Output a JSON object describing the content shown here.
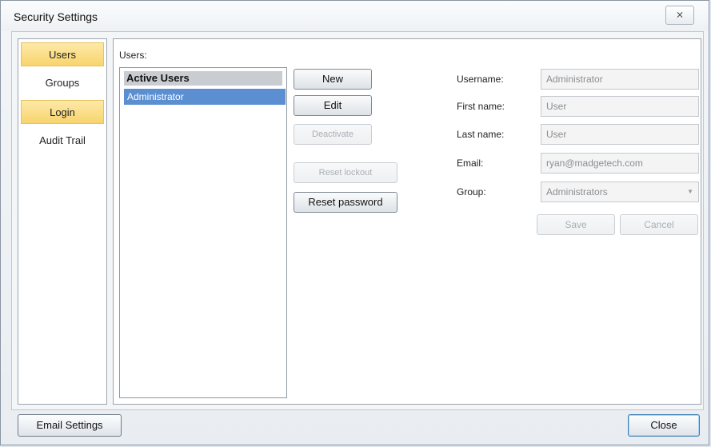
{
  "window": {
    "title": "Security Settings",
    "close_glyph": "⨯"
  },
  "nav": {
    "items": [
      {
        "label": "Users",
        "selected": true
      },
      {
        "label": "Groups",
        "selected": false
      },
      {
        "label": "Login",
        "selected": true
      },
      {
        "label": "Audit Trail",
        "selected": false
      }
    ]
  },
  "users_panel": {
    "label": "Users:",
    "list_header": "Active Users",
    "list_items": [
      "Administrator"
    ]
  },
  "actions": {
    "new": "New",
    "edit": "Edit",
    "deactivate": "Deactivate",
    "reset_lockout": "Reset lockout",
    "reset_password": "Reset password"
  },
  "form": {
    "username_label": "Username:",
    "username_value": "Administrator",
    "first_name_label": "First name:",
    "first_name_value": "User",
    "last_name_label": "Last name:",
    "last_name_value": "User",
    "email_label": "Email:",
    "email_value": "ryan@madgetech.com",
    "group_label": "Group:",
    "group_value": "Administrators",
    "save": "Save",
    "cancel": "Cancel"
  },
  "footer": {
    "email_settings": "Email Settings",
    "close": "Close"
  },
  "colors": {
    "nav_selected": "#f7d46c",
    "list_selected": "#5b8fd1"
  }
}
